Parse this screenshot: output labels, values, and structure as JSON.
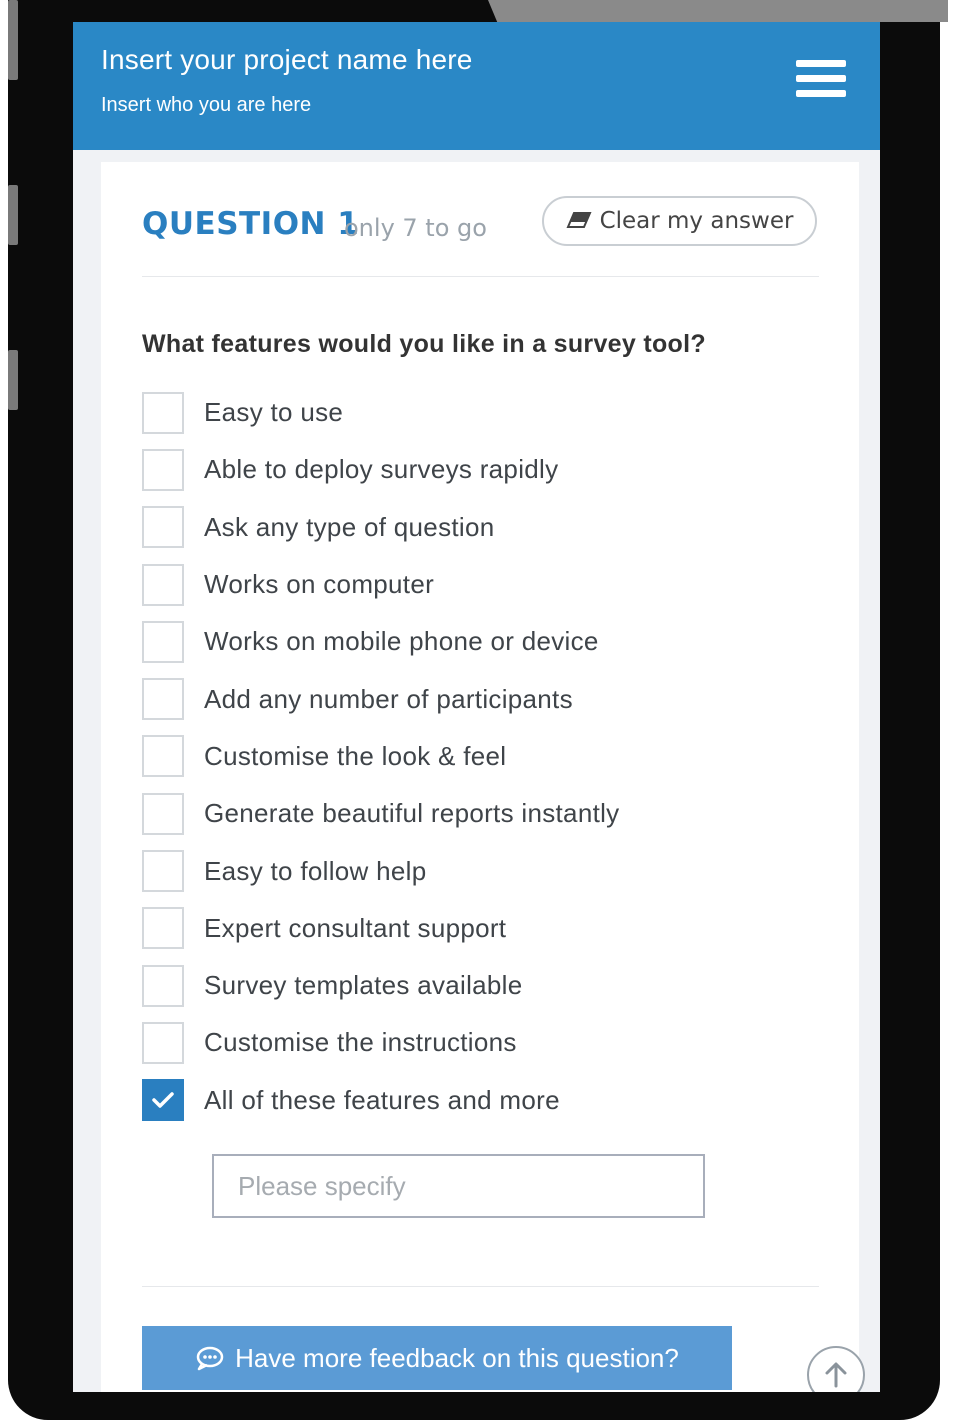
{
  "header": {
    "project_name": "Insert your project name here",
    "subtitle": "Insert who you are here",
    "menu_icon": "hamburger-menu-icon"
  },
  "question": {
    "number_label": "QUESTION 1",
    "remaining_label": "only 7 to go",
    "clear_button_label": "Clear my answer",
    "clear_icon": "eraser-icon",
    "text": "What features would you like in a survey tool?",
    "options": [
      {
        "label": "Easy to use",
        "checked": false
      },
      {
        "label": "Able to deploy surveys rapidly",
        "checked": false
      },
      {
        "label": "Ask any type of question",
        "checked": false
      },
      {
        "label": "Works on computer",
        "checked": false
      },
      {
        "label": "Works on mobile phone or device",
        "checked": false
      },
      {
        "label": "Add any number of participants",
        "checked": false
      },
      {
        "label": "Customise the look & feel",
        "checked": false
      },
      {
        "label": "Generate beautiful reports instantly",
        "checked": false
      },
      {
        "label": "Easy to follow help",
        "checked": false
      },
      {
        "label": "Expert consultant support",
        "checked": false
      },
      {
        "label": "Survey templates available",
        "checked": false
      },
      {
        "label": "Customise the instructions",
        "checked": false
      },
      {
        "label": "All of these features and more",
        "checked": true
      }
    ],
    "specify_placeholder": "Please specify",
    "specify_value": ""
  },
  "footer": {
    "feedback_button_label": "Have more feedback on this question?",
    "feedback_icon": "chat-bubble-icon",
    "scroll_top_icon": "arrow-up-circle-icon"
  },
  "colors": {
    "header_bg": "#2a88c6",
    "accent": "#2a7fc0",
    "feedback_button_bg": "#5b9bd5"
  }
}
